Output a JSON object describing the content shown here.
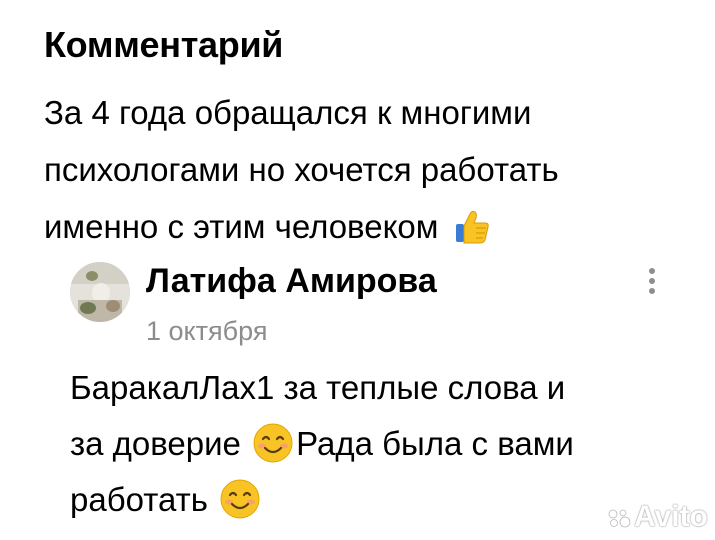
{
  "comment": {
    "heading": "Комментарий",
    "line1": "За 4 года обращался к многими",
    "line2": "психологами но хочется работать",
    "line3": "именно с этим человеком",
    "emoji": "thumbs-up-icon"
  },
  "reply": {
    "author": "Латифа Амирова",
    "date": "1 октября",
    "line1": "БаракалЛах1 за теплые слова и",
    "line2_a": "за доверие",
    "line2_b": "Рада  была с вами",
    "line3": "работать",
    "emoji": "smiling-face-icon"
  },
  "menu": {
    "icon": "more-vertical-icon"
  },
  "watermark": {
    "text": "Avito"
  },
  "colors": {
    "text": "#000000",
    "muted": "#8c8c8c",
    "emoji_yellow": "#f7c325"
  }
}
